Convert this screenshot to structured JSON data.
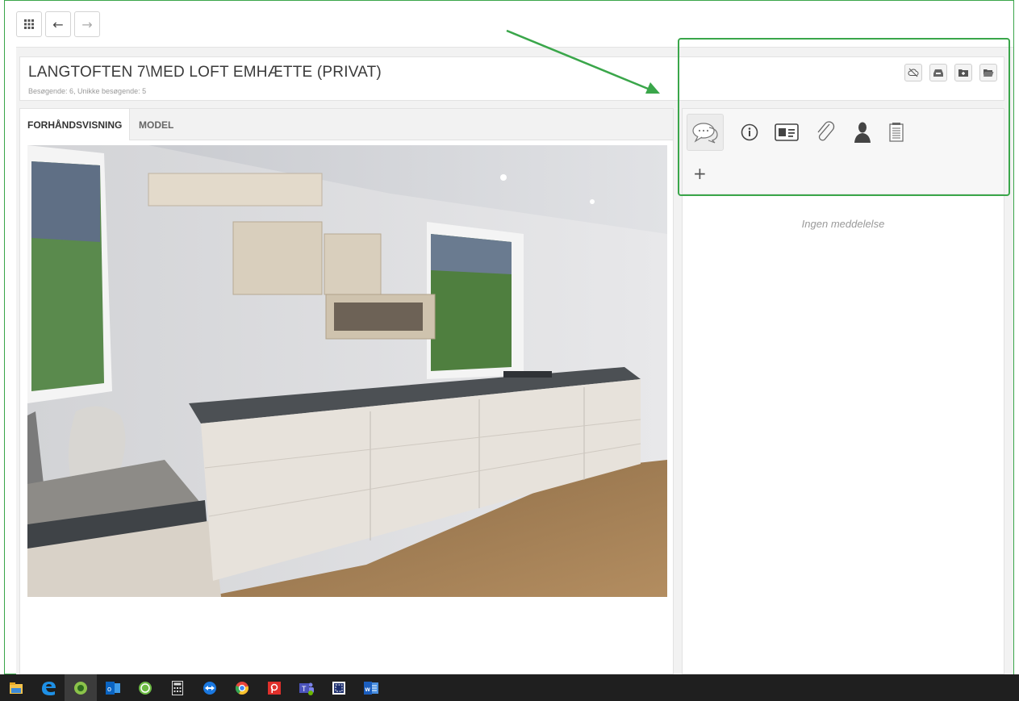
{
  "toolbar": {
    "apps_icon": "apps-grid-icon",
    "back_glyph": "←",
    "forward_glyph": "→"
  },
  "header": {
    "title": "LANGTOFTEN 7\\MED LOFT EMHÆTTE (PRIVAT)",
    "subtitle": "Besøgende: 6, Unikke besøgende: 5",
    "icons": [
      "cloud-off-icon",
      "inbox-icon",
      "folder-plus-icon",
      "folder-open-icon"
    ]
  },
  "tabs": [
    {
      "label": "FORHÅNDSVISNING",
      "active": true
    },
    {
      "label": "MODEL",
      "active": false
    }
  ],
  "side_panel": {
    "icons": [
      "chat-icon",
      "info-icon",
      "contact-card-icon",
      "paperclip-icon",
      "user-icon",
      "notepad-icon"
    ],
    "add_glyph": "+",
    "empty_message": "Ingen meddelelse"
  },
  "taskbar": {
    "apps": [
      "file-explorer-icon",
      "edge-icon",
      "app-green-icon",
      "outlook-icon",
      "app-circle-icon",
      "calculator-icon",
      "teamviewer-icon",
      "chrome-icon",
      "pdf-icon",
      "teams-icon",
      "screen-capture-icon",
      "word-icon"
    ]
  },
  "colors": {
    "highlight": "#3aa64a",
    "taskbar": "#1f1f1f"
  }
}
